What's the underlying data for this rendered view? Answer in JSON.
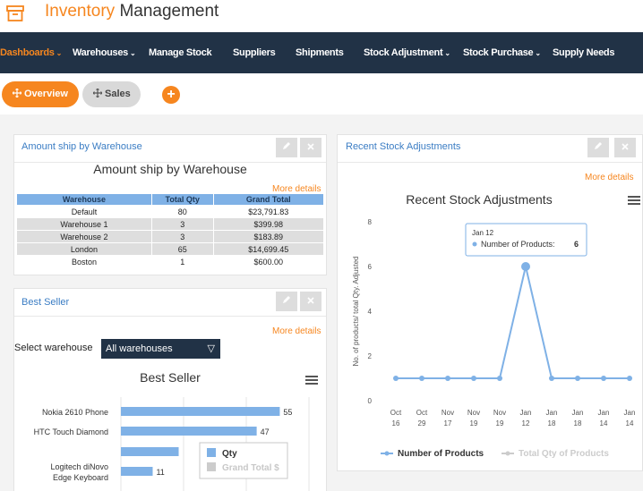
{
  "app": {
    "title_part1": "Inventory",
    "title_part2": "Management",
    "icon": "archive-box-icon"
  },
  "nav": {
    "items": [
      {
        "label": "Dashboards",
        "caret": true,
        "active": true
      },
      {
        "label": "Warehouses",
        "caret": true
      },
      {
        "label": "Manage Stock",
        "caret": false
      },
      {
        "label": "Suppliers",
        "caret": false
      },
      {
        "label": "Shipments",
        "caret": false
      },
      {
        "label": "Stock Adjustment",
        "caret": true
      },
      {
        "label": "Stock Purchase",
        "caret": true
      },
      {
        "label": "Supply Needs",
        "caret": false
      }
    ],
    "caret_glyph": "⌄"
  },
  "subtabs": {
    "overview": {
      "label": "Overview",
      "icon": "move-icon"
    },
    "sales": {
      "label": "Sales",
      "icon": "move-icon"
    },
    "add": "+"
  },
  "panel_ship": {
    "title": "Amount ship by Warehouse",
    "heading": "Amount ship by Warehouse",
    "more": "More details",
    "columns": [
      "Warehouse",
      "Total Qty",
      "Grand Total"
    ],
    "rows": [
      [
        "Default",
        "80",
        "$23,791.83"
      ],
      [
        "Warehouse 1",
        "3",
        "$399.98"
      ],
      [
        "Warehouse 2",
        "3",
        "$183.89"
      ],
      [
        "London",
        "65",
        "$14,699.45"
      ],
      [
        "Boston",
        "1",
        "$600.00"
      ]
    ]
  },
  "panel_best": {
    "title": "Best Seller",
    "more": "More details",
    "select_label": "Select warehouse",
    "select_value": "All warehouses",
    "select_arrow": "▽"
  },
  "panel_recent": {
    "title": "Recent Stock Adjustments",
    "more": "More details"
  },
  "chart_data": [
    {
      "type": "bar",
      "title": "Best Seller",
      "orientation": "horizontal",
      "categories": [
        "Nokia 2610 Phone",
        "HTC Touch Diamond",
        "",
        "Logitech diNovo Edge Keyboard"
      ],
      "series": [
        {
          "name": "Qty",
          "values": [
            55,
            47,
            20,
            11
          ],
          "color": "#7fb1e6"
        },
        {
          "name": "Grand Total $",
          "values": [],
          "color": "#cccccc"
        }
      ],
      "data_labels": [
        "55",
        "47",
        "",
        "11"
      ],
      "tooltip_legend": [
        "Qty",
        "Grand Total $"
      ]
    },
    {
      "type": "line",
      "title": "Recent Stock Adjustments",
      "ylabel": "No. of products/ total Qty. Adjusted",
      "x": [
        "Oct 16",
        "Oct 29",
        "Nov 17",
        "Nov 19",
        "Nov 19",
        "Jan 12",
        "Jan 18",
        "Jan 18",
        "Jan 14",
        "Jan 14"
      ],
      "ylim": [
        0,
        8
      ],
      "yticks": [
        0,
        2,
        4,
        6,
        8
      ],
      "series": [
        {
          "name": "Number of Products",
          "values": [
            1,
            1,
            1,
            1,
            1,
            6,
            1,
            1,
            1,
            1
          ],
          "color": "#7fb1e6"
        },
        {
          "name": "Total Qty of Products",
          "values": [],
          "color": "#cccccc"
        }
      ],
      "tooltip": {
        "date": "Jan 12",
        "series": "Number of Products",
        "value": "6"
      },
      "legend": "bottom"
    }
  ]
}
